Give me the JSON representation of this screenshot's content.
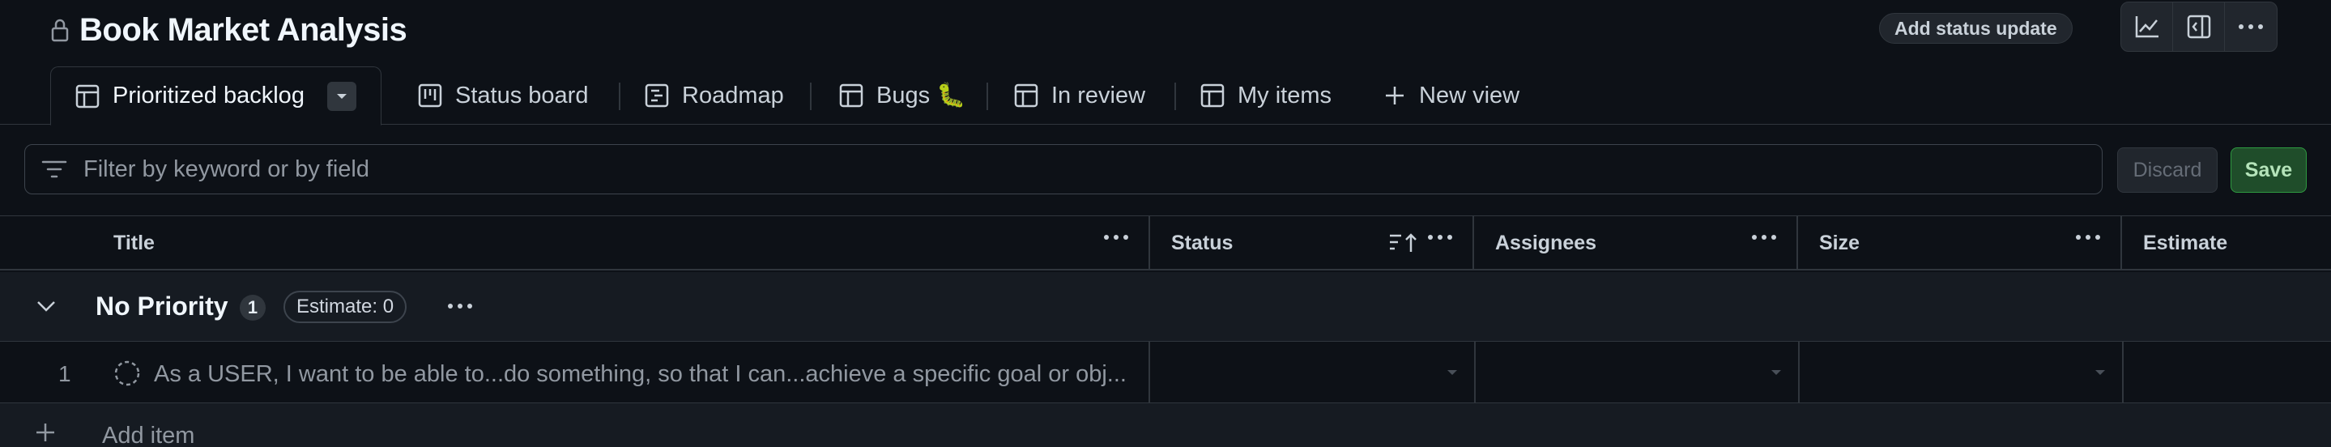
{
  "project": {
    "title": "Book Market Analysis"
  },
  "header": {
    "status_update_label": "Add status update"
  },
  "tabs": [
    {
      "label": "Prioritized backlog"
    },
    {
      "label": "Status board"
    },
    {
      "label": "Roadmap"
    },
    {
      "label": "Bugs 🐛"
    },
    {
      "label": "In review"
    },
    {
      "label": "My items"
    },
    {
      "label": "New view"
    }
  ],
  "filter": {
    "placeholder": "Filter by keyword or by field",
    "discard_label": "Discard",
    "save_label": "Save"
  },
  "columns": [
    {
      "label": "Title"
    },
    {
      "label": "Status"
    },
    {
      "label": "Assignees"
    },
    {
      "label": "Size"
    },
    {
      "label": "Estimate"
    }
  ],
  "group": {
    "title": "No Priority",
    "count": "1",
    "estimate": "Estimate: 0"
  },
  "items": [
    {
      "number": "1",
      "title": "As a USER, I want to be able to...do something, so that I can...achieve a specific goal or obj..."
    }
  ],
  "add_item_label": "Add item",
  "colors": {
    "background": "#0d1117",
    "border": "#30363d",
    "save_green": "#238636"
  }
}
